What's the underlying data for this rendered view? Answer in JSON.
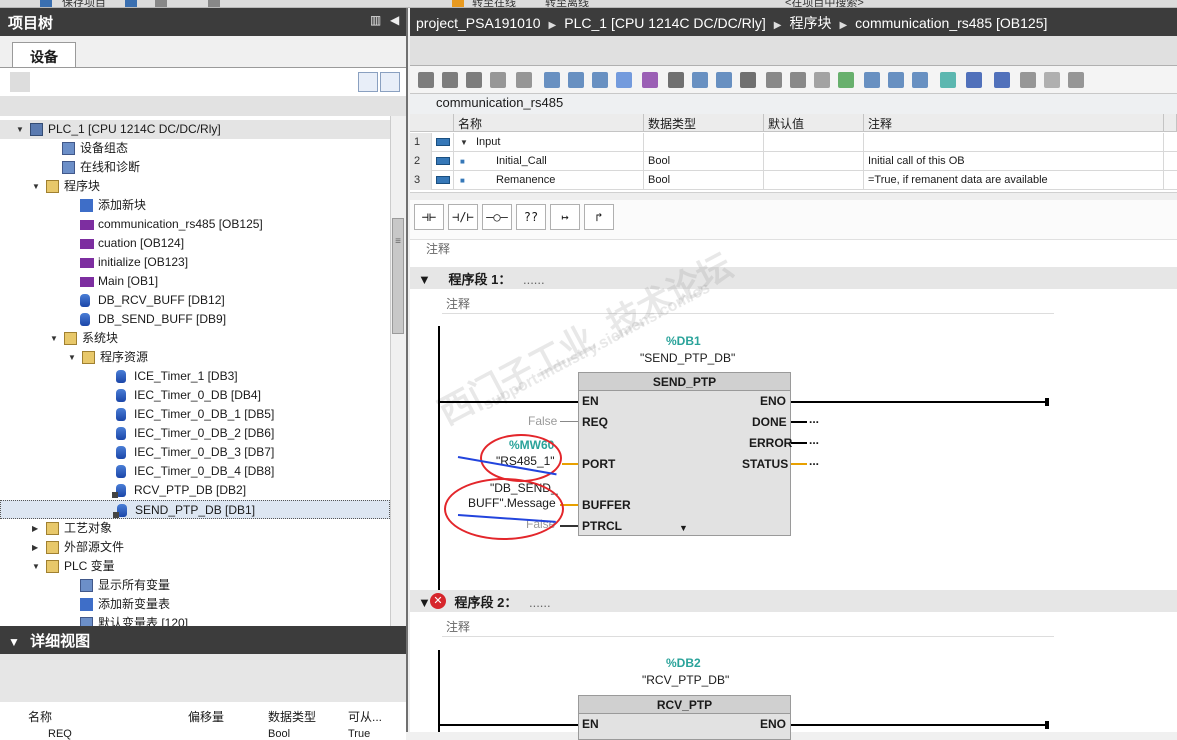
{
  "app": {
    "top_menu": [
      "保存项目",
      "转至在线",
      "转至离线",
      "<在项目中搜索>"
    ]
  },
  "left": {
    "panel_title": "项目树",
    "tab": "设备",
    "tree": [
      {
        "label": "PLC_1 [CPU 1214C DC/DC/Rly]",
        "icon": "plc-icon",
        "twisty": "▼"
      },
      {
        "label": "设备组态",
        "icon": "device-config-icon"
      },
      {
        "label": "在线和诊断",
        "icon": "online-diag-icon"
      },
      {
        "label": "程序块",
        "icon": "folder-icon",
        "twisty": "▼"
      },
      {
        "label": "添加新块",
        "icon": "add-block-icon"
      },
      {
        "label": "communication_rs485 [OB125]",
        "icon": "ob-icon"
      },
      {
        "label": "cuation [OB124]",
        "icon": "ob-icon"
      },
      {
        "label": "initialize [OB123]",
        "icon": "ob-icon"
      },
      {
        "label": "Main [OB1]",
        "icon": "ob-icon"
      },
      {
        "label": "DB_RCV_BUFF [DB12]",
        "icon": "db-icon"
      },
      {
        "label": "DB_SEND_BUFF [DB9]",
        "icon": "db-icon"
      },
      {
        "label": "系统块",
        "icon": "folder-icon",
        "twisty": "▼"
      },
      {
        "label": "程序资源",
        "icon": "folder-icon",
        "twisty": "▼"
      },
      {
        "label": "ICE_Timer_1 [DB3]",
        "icon": "db-icon"
      },
      {
        "label": "IEC_Timer_0_DB [DB4]",
        "icon": "db-icon"
      },
      {
        "label": "IEC_Timer_0_DB_1 [DB5]",
        "icon": "db-icon"
      },
      {
        "label": "IEC_Timer_0_DB_2 [DB6]",
        "icon": "db-icon"
      },
      {
        "label": "IEC_Timer_0_DB_3 [DB7]",
        "icon": "db-icon"
      },
      {
        "label": "IEC_Timer_0_DB_4 [DB8]",
        "icon": "db-icon"
      },
      {
        "label": "RCV_PTP_DB [DB2]",
        "icon": "db-icon"
      },
      {
        "label": "SEND_PTP_DB [DB1]",
        "icon": "db-icon"
      },
      {
        "label": "工艺对象",
        "icon": "folder-icon",
        "twisty": "▶"
      },
      {
        "label": "外部源文件",
        "icon": "folder-icon",
        "twisty": "▶"
      },
      {
        "label": "PLC 变量",
        "icon": "folder-icon",
        "twisty": "▼"
      },
      {
        "label": "显示所有变量",
        "icon": "tag-table-icon"
      },
      {
        "label": "添加新变量表",
        "icon": "add-tag-table-icon"
      },
      {
        "label": "默认变量表 [120]",
        "icon": "tag-table-icon"
      }
    ],
    "detail_title": "详细视图",
    "detail_columns": [
      "名称",
      "偏移量",
      "数据类型",
      "可从..."
    ],
    "detail_row": [
      "REQ",
      "",
      "Bool",
      "True"
    ]
  },
  "right": {
    "breadcrumb": [
      "project_PSA191010",
      "PLC_1 [CPU 1214C DC/DC/Rly]",
      "程序块",
      "communication_rs485 [OB125]"
    ],
    "block_name": "communication_rs485",
    "iface_columns": [
      "名称",
      "数据类型",
      "默认值",
      "注释"
    ],
    "iface_rows": [
      {
        "num": "1",
        "name": "Input",
        "type": "",
        "default": "",
        "comment": ""
      },
      {
        "num": "2",
        "name": "Initial_Call",
        "type": "Bool",
        "default": "",
        "comment": "Initial call of this OB"
      },
      {
        "num": "3",
        "name": "Remanence",
        "type": "Bool",
        "default": "",
        "comment": "=True, if remanent data are available"
      }
    ],
    "ladder_buttons": [
      "⊣⊢",
      "⊣/⊢",
      "–○–",
      "??",
      "↦",
      "↱"
    ],
    "block_comment": "注释",
    "network1": {
      "title": "程序段 1：",
      "dots": "......",
      "comment": "注释",
      "db_addr": "%DB1",
      "db_name": "\"SEND_PTP_DB\"",
      "fb_name": "SEND_PTP",
      "in_pins": [
        "EN",
        "REQ",
        "PORT",
        "BUFFER",
        "PTRCL"
      ],
      "out_pins": [
        "ENO",
        "DONE",
        "ERROR",
        "STATUS"
      ],
      "req_val": "False",
      "port_addr": "%MW60",
      "port_val": "\"RS485_1\"",
      "buffer_val_1": "\"DB_SEND_",
      "buffer_val_2": "BUFF\".Message",
      "ptrcl_val": "False",
      "out_dots": "..."
    },
    "network2": {
      "title": "程序段 2：",
      "dots": "......",
      "comment": "注释",
      "db_addr": "%DB2",
      "db_name": "\"RCV_PTP_DB\"",
      "fb_name": "RCV_PTP",
      "in_pin": "EN",
      "out_pin": "ENO"
    },
    "watermark": [
      "西门子工业",
      "技术论坛",
      "support.industry.siemens.com/cs"
    ]
  }
}
